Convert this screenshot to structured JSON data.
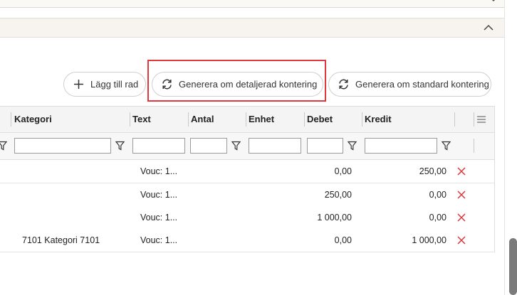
{
  "toolbar": {
    "add_row_label": "Lägg till rad",
    "regen_detailed_label": "Generera om detaljerad kontering",
    "regen_standard_label": "Generera om standard kontering"
  },
  "grid": {
    "columns": [
      "Kategori",
      "Text",
      "Antal",
      "Enhet",
      "Debet",
      "Kredit"
    ],
    "filters": {
      "kategori": "",
      "text": "",
      "antal": "",
      "enhet": "",
      "debet": "",
      "kredit": ""
    },
    "rows": [
      {
        "kategori": "",
        "text": "Vouc: 1...",
        "debet": "0,00",
        "kredit": "250,00"
      },
      {
        "kategori": "",
        "text": "Vouc: 1...",
        "debet": "250,00",
        "kredit": "0,00"
      },
      {
        "kategori": "",
        "text": "Vouc: 1...",
        "debet": "1 000,00",
        "kredit": "0,00"
      },
      {
        "kategori": "7101  Kategori 7101",
        "text": "Vouc: 1...",
        "debet": "0,00",
        "kredit": "1 000,00"
      }
    ]
  },
  "colors": {
    "highlight": "#e0383e",
    "delete_icon": "#d9363e",
    "panel_header": "#f7f3ee"
  }
}
